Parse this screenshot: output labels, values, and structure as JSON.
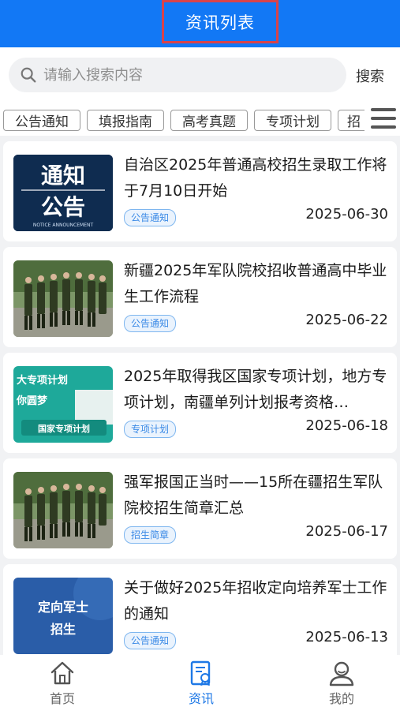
{
  "header": {
    "title": "资讯列表"
  },
  "search": {
    "placeholder": "请输入搜索内容",
    "button_label": "搜索"
  },
  "categories": [
    "公告通知",
    "填报指南",
    "高考真题",
    "专项计划",
    "招"
  ],
  "articles": [
    {
      "title": "自治区2025年普通高校招生录取工作将于7月10日开始",
      "tag": "公告通知",
      "date": "2025-06-30",
      "thumb_text": [
        "通知",
        "公告",
        "NOTICE ANNOUNCEMENT"
      ]
    },
    {
      "title": "新疆2025年军队院校招收普通高中毕业生工作流程",
      "tag": "公告通知",
      "date": "2025-06-22"
    },
    {
      "title": "2025年取得我区国家专项计划，地方专项计划，南疆单列计划报考资格…",
      "tag": "专项计划",
      "date": "2025-06-18",
      "thumb_text": [
        "大专项计划",
        "你圆梦",
        "国家专项计划"
      ]
    },
    {
      "title": "强军报国正当时——15所在疆招生军队院校招生简章汇总",
      "tag": "招生简章",
      "date": "2025-06-17"
    },
    {
      "title": "关于做好2025年招收定向培养军士工作的通知",
      "tag": "公告通知",
      "date": "2025-06-13",
      "thumb_text": [
        "定向军士",
        "招生"
      ]
    }
  ],
  "tabbar": [
    {
      "label": "首页",
      "icon": "home-icon"
    },
    {
      "label": "资讯",
      "icon": "news-icon",
      "active": true
    },
    {
      "label": "我的",
      "icon": "profile-icon"
    }
  ],
  "colors": {
    "brand": "#1278f5",
    "tag_text": "#3b8ae6",
    "active_tab": "#1e78e6"
  }
}
